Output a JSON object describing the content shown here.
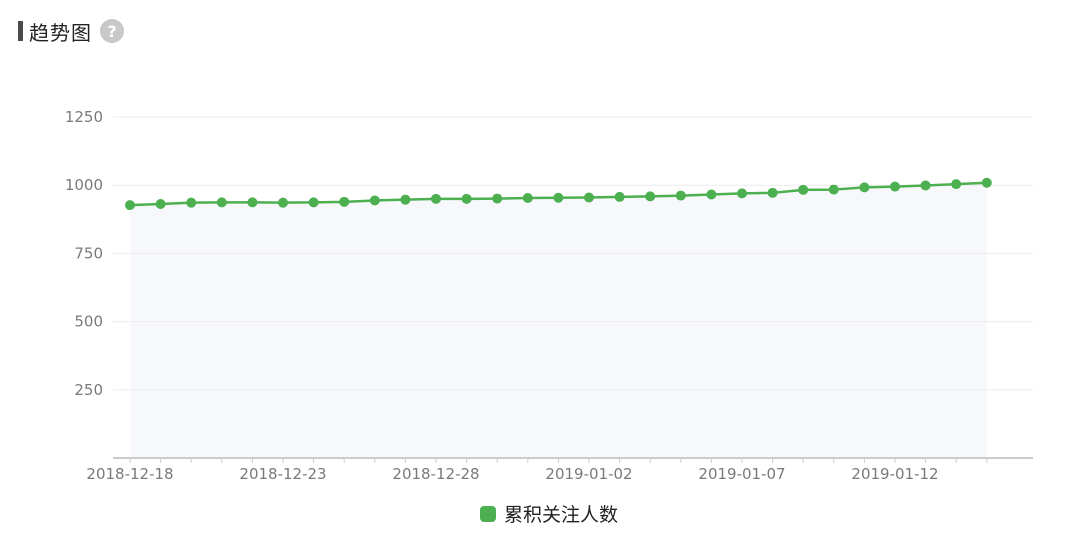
{
  "header": {
    "title": "趋势图",
    "help_glyph": "?",
    "help_icon": "question-circle-icon"
  },
  "colors": {
    "series": "#4caf50",
    "area_fill": "#f7f8fc",
    "grid": "#ececec",
    "axis": "#cccccc"
  },
  "chart_data": {
    "type": "line",
    "title": "",
    "xlabel": "",
    "ylabel": "",
    "ylim": [
      0,
      1250
    ],
    "yticks": [
      250,
      500,
      750,
      1000,
      1250
    ],
    "grid": true,
    "legend_position": "bottom",
    "x": [
      "2018-12-18",
      "2018-12-19",
      "2018-12-20",
      "2018-12-21",
      "2018-12-22",
      "2018-12-23",
      "2018-12-24",
      "2018-12-25",
      "2018-12-26",
      "2018-12-27",
      "2018-12-28",
      "2018-12-29",
      "2018-12-30",
      "2018-12-31",
      "2019-01-01",
      "2019-01-02",
      "2019-01-03",
      "2019-01-04",
      "2019-01-05",
      "2019-01-06",
      "2019-01-07",
      "2019-01-08",
      "2019-01-09",
      "2019-01-10",
      "2019-01-11",
      "2019-01-12",
      "2019-01-13",
      "2019-01-14",
      "2019-01-15"
    ],
    "xtick_labels": [
      "2018-12-18",
      "2018-12-23",
      "2018-12-28",
      "2019-01-02",
      "2019-01-07",
      "2019-01-12"
    ],
    "series": [
      {
        "name": "累积关注人数",
        "values": [
          927,
          931,
          936,
          937,
          937,
          936,
          937,
          939,
          944,
          947,
          950,
          950,
          951,
          953,
          954,
          955,
          957,
          959,
          962,
          966,
          970,
          972,
          983,
          984,
          992,
          995,
          999,
          1004,
          1009
        ]
      }
    ]
  }
}
